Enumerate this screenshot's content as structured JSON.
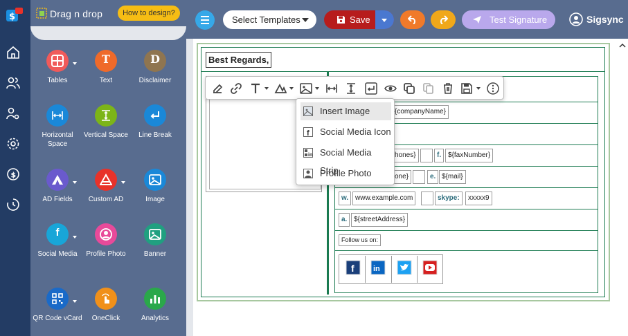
{
  "app": {
    "panel_title": "Drag n drop",
    "howto_label": "How to design?"
  },
  "rail": {
    "items": [
      "home",
      "users",
      "user-settings",
      "settings",
      "billing",
      "history"
    ]
  },
  "tiles": [
    {
      "label": "Tables",
      "icon": "table-icon",
      "color": "#f05a5a"
    },
    {
      "label": "Text",
      "icon": "text-icon",
      "color": "#ef6a2a",
      "letter": "T"
    },
    {
      "label": "Disclaimer",
      "icon": "disclaimer-icon",
      "color": "#8f7550",
      "letter": "D"
    },
    {
      "label": "Horizontal Space",
      "icon": "horizontal-space-icon",
      "color": "#1a88d8"
    },
    {
      "label": "Vertical Space",
      "icon": "vertical-space-icon",
      "color": "#7cb518"
    },
    {
      "label": "Line Break",
      "icon": "line-break-icon",
      "color": "#1a88d8"
    },
    {
      "label": "AD Fields",
      "icon": "ad-fields-icon",
      "color": "#6a5acd"
    },
    {
      "label": "Custom AD",
      "icon": "custom-ad-icon",
      "color": "#e8322a"
    },
    {
      "label": "Image",
      "icon": "image-icon",
      "color": "#1a88d8"
    },
    {
      "label": "Social Media",
      "icon": "social-media-icon",
      "color": "#18a6d8"
    },
    {
      "label": "Profile Photo",
      "icon": "profile-photo-icon",
      "color": "#e84a9a"
    },
    {
      "label": "Banner",
      "icon": "banner-icon",
      "color": "#20a080"
    },
    {
      "label": "QR Code vCard",
      "icon": "qr-code-icon",
      "color": "#1a6ac8"
    },
    {
      "label": "OneClick",
      "icon": "oneclick-icon",
      "color": "#f0901a"
    },
    {
      "label": "Analytics",
      "icon": "analytics-icon",
      "color": "#2aa84a"
    }
  ],
  "topbar": {
    "select_templates": "Select Templates",
    "save_label": "Save",
    "test_signature": "Test Signature",
    "user_name": "Sigsync"
  },
  "signature": {
    "greeting": "Best Regards,",
    "company": "{companyName}",
    "phones": "hones}",
    "fax_key": "f.",
    "fax": "${faxNumber}",
    "mobile": "one}",
    "email_key": "e.",
    "email": "${mail}",
    "web_key": "w.",
    "web": "www.example.com",
    "skype_key": "skype:",
    "skype": "xxxxx9",
    "address_key": "a.",
    "address": "${streetAddress}",
    "follow": "Follow us on:"
  },
  "insert_menu": {
    "items": [
      {
        "label": "Insert Image",
        "icon": "insert-image-icon"
      },
      {
        "label": "Social Media Icon",
        "icon": "facebook-icon"
      },
      {
        "label": "Social Media Strip",
        "icon": "social-strip-icon"
      },
      {
        "label": "Profile Photo",
        "icon": "profile-photo-icon"
      }
    ]
  },
  "social": [
    "facebook",
    "linkedin",
    "twitter",
    "youtube"
  ],
  "colors": {
    "rail": "#233c64",
    "panel": "#586c8f",
    "save": "#b71c1c",
    "accent": "#f07a2a"
  }
}
